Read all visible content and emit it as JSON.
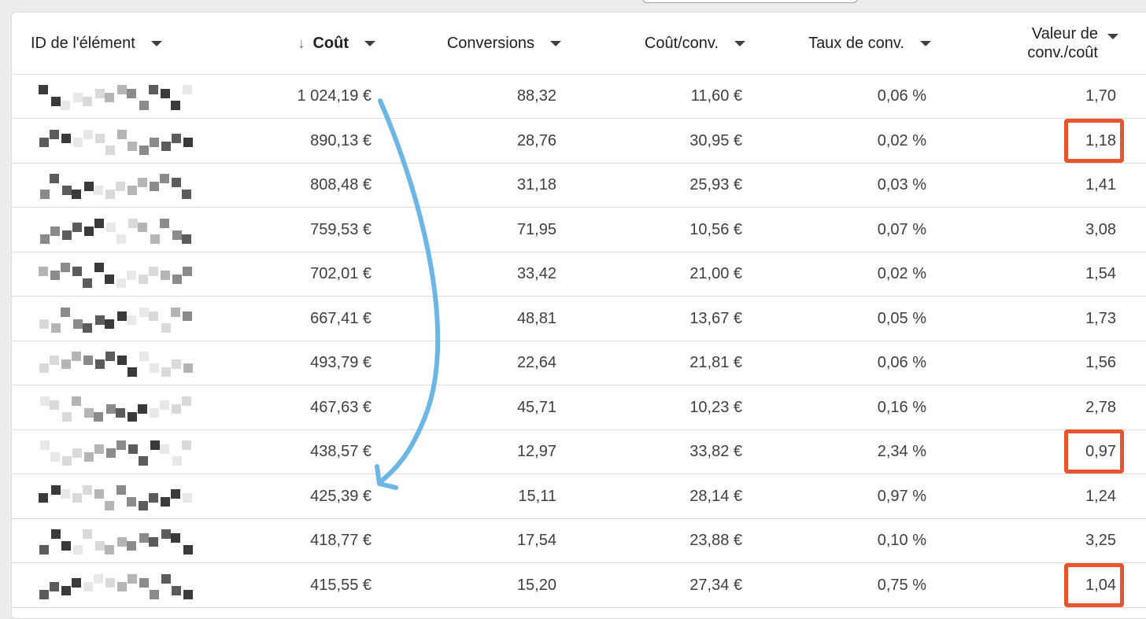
{
  "columns": [
    {
      "key": "id",
      "label": "ID de l'élément"
    },
    {
      "key": "cost",
      "label": "Coût"
    },
    {
      "key": "conversions",
      "label": "Conversions"
    },
    {
      "key": "cost_per_conv",
      "label": "Coût/conv."
    },
    {
      "key": "conv_rate",
      "label": "Taux de conv."
    },
    {
      "key": "value_per_cost",
      "label": "Valeur de conv./coût"
    }
  ],
  "sort": {
    "column": "cost",
    "direction": "desc",
    "icon": "arrow-down-icon"
  },
  "rows": [
    {
      "cost": "1 024,19 €",
      "conversions": "88,32",
      "cost_per_conv": "11,60 €",
      "conv_rate": "0,06 %",
      "value_per_cost": "1,70"
    },
    {
      "cost": "890,13 €",
      "conversions": "28,76",
      "cost_per_conv": "30,95 €",
      "conv_rate": "0,02 %",
      "value_per_cost": "1,18"
    },
    {
      "cost": "808,48 €",
      "conversions": "31,18",
      "cost_per_conv": "25,93 €",
      "conv_rate": "0,03 %",
      "value_per_cost": "1,41"
    },
    {
      "cost": "759,53 €",
      "conversions": "71,95",
      "cost_per_conv": "10,56 €",
      "conv_rate": "0,07 %",
      "value_per_cost": "3,08"
    },
    {
      "cost": "702,01 €",
      "conversions": "33,42",
      "cost_per_conv": "21,00 €",
      "conv_rate": "0,02 %",
      "value_per_cost": "1,54"
    },
    {
      "cost": "667,41 €",
      "conversions": "48,81",
      "cost_per_conv": "13,67 €",
      "conv_rate": "0,05 %",
      "value_per_cost": "1,73"
    },
    {
      "cost": "493,79 €",
      "conversions": "22,64",
      "cost_per_conv": "21,81 €",
      "conv_rate": "0,06 %",
      "value_per_cost": "1,56"
    },
    {
      "cost": "467,63 €",
      "conversions": "45,71",
      "cost_per_conv": "10,23 €",
      "conv_rate": "0,16 %",
      "value_per_cost": "2,78"
    },
    {
      "cost": "438,57 €",
      "conversions": "12,97",
      "cost_per_conv": "33,82 €",
      "conv_rate": "2,34 %",
      "value_per_cost": "0,97"
    },
    {
      "cost": "425,39 €",
      "conversions": "15,11",
      "cost_per_conv": "28,14 €",
      "conv_rate": "0,97 %",
      "value_per_cost": "1,24"
    },
    {
      "cost": "418,77 €",
      "conversions": "17,54",
      "cost_per_conv": "23,88 €",
      "conv_rate": "0,10 %",
      "value_per_cost": "3,25"
    },
    {
      "cost": "415,55 €",
      "conversions": "15,20",
      "cost_per_conv": "27,34 €",
      "conv_rate": "0,75 %",
      "value_per_cost": "1,04"
    }
  ],
  "highlighted_rows": [
    1,
    8,
    11
  ],
  "colors": {
    "highlight": "#e8542b",
    "annotation_arrow": "#6bb6e4",
    "text": "#3c4043",
    "border": "#dadce0"
  },
  "annotations": {
    "arrow_icon": "curved-arrow-icon"
  }
}
